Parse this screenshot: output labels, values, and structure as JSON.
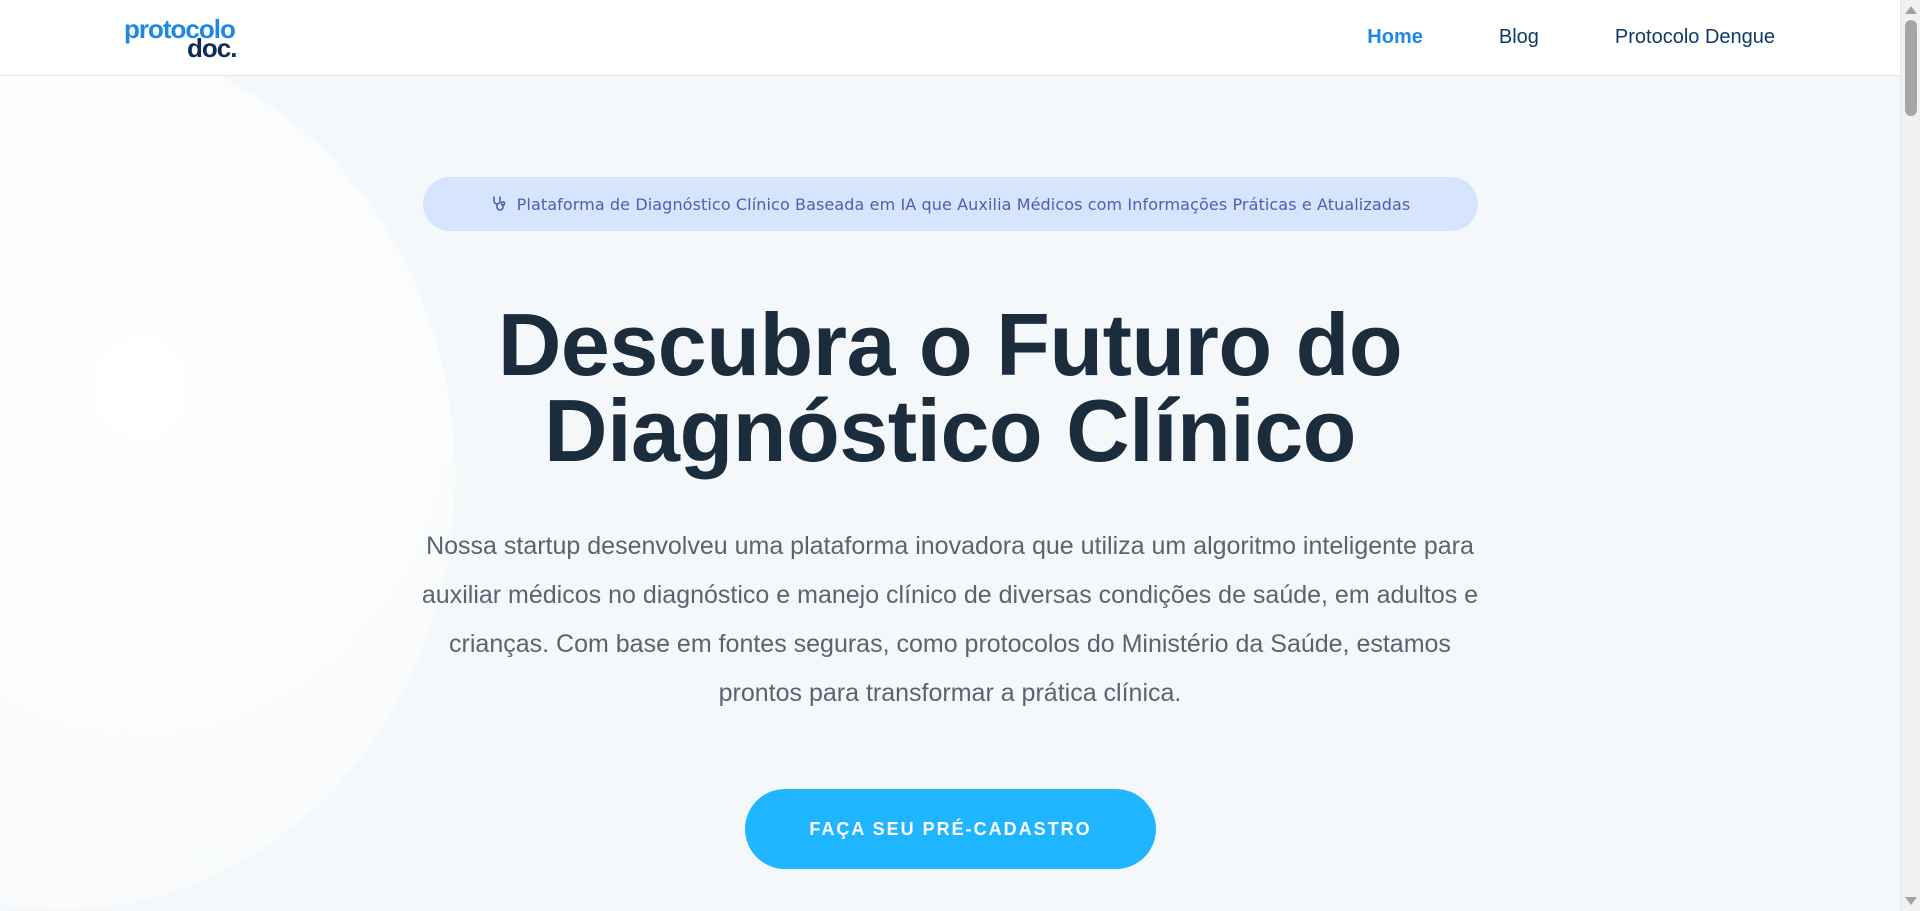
{
  "header": {
    "logo": {
      "line1": "protocolo",
      "line2": "doc."
    },
    "nav": [
      {
        "label": "Home",
        "active": true
      },
      {
        "label": "Blog",
        "active": false
      },
      {
        "label": "Protocolo Dengue",
        "active": false
      }
    ]
  },
  "hero": {
    "badge": {
      "icon": "stethoscope-icon",
      "text": "Plataforma de Diagnóstico Clínico Baseada em IA que Auxilia Médicos com Informações Práticas e Atualizadas"
    },
    "title_line1": "Descubra o Futuro do",
    "title_line2": "Diagnóstico Clínico",
    "description": "Nossa startup desenvolveu uma plataforma inovadora que utiliza um algoritmo inteligente para auxiliar médicos no diagnóstico e manejo clínico de diversas condições de saúde, em adultos e crianças. Com base em fontes seguras, como protocolos do Ministério da Saúde, estamos prontos para transformar a prática clínica.",
    "cta_label": "FAÇA SEU PRÉ-CADASTRO"
  },
  "colors": {
    "brand_blue": "#1e88e5",
    "brand_navy": "#0d2d57",
    "cta": "#1fb6ff",
    "badge_bg": "#d6e4fd",
    "title": "#1b2d3c"
  }
}
